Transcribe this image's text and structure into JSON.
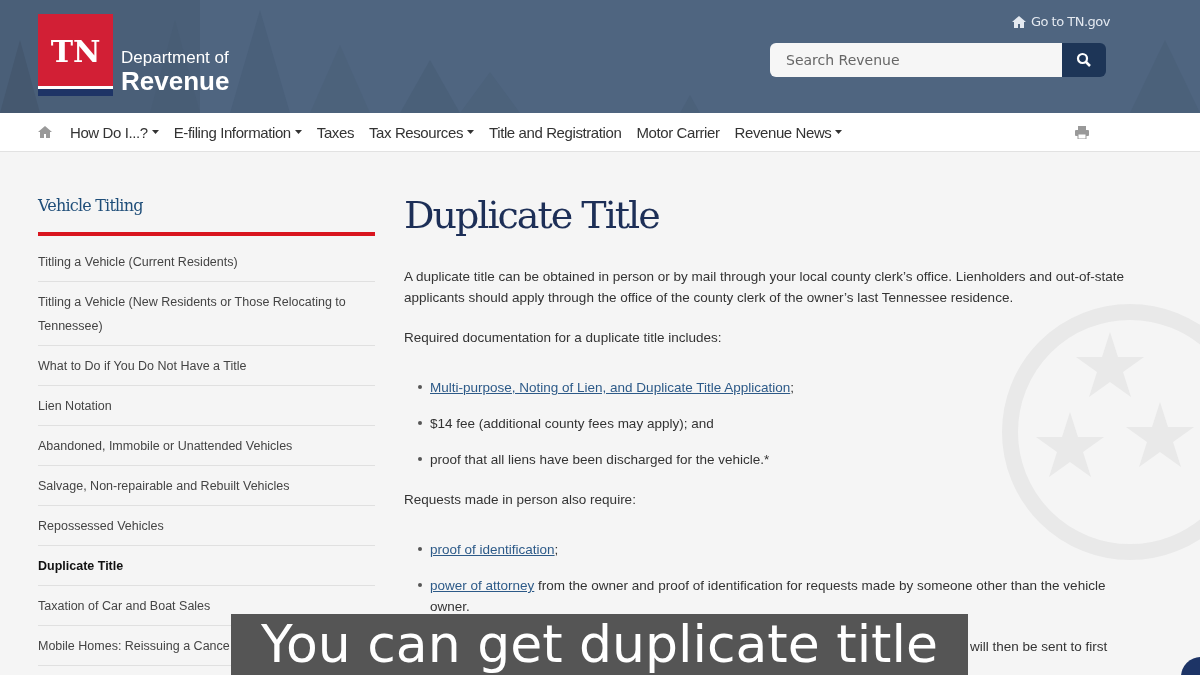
{
  "header": {
    "logo_mark": "TN",
    "logo_line1": "Department of",
    "logo_line2": "Revenue",
    "top_link": "Go to TN.gov",
    "search": {
      "placeholder": "Search Revenue"
    }
  },
  "nav": [
    {
      "label": "How Do I...?",
      "dropdown": true
    },
    {
      "label": "E-filing Information",
      "dropdown": true
    },
    {
      "label": "Taxes",
      "dropdown": false
    },
    {
      "label": "Tax Resources",
      "dropdown": true
    },
    {
      "label": "Title and Registration",
      "dropdown": false
    },
    {
      "label": "Motor Carrier",
      "dropdown": false
    },
    {
      "label": "Revenue News",
      "dropdown": true
    }
  ],
  "sidebar": {
    "title": "Vehicle Titling",
    "items": [
      {
        "label": "Titling a Vehicle (Current Residents)",
        "selected": false
      },
      {
        "label": "Titling a Vehicle (New Residents or Those Relocating to Tennessee)",
        "selected": false
      },
      {
        "label": "What to Do if You Do Not Have a Title",
        "selected": false
      },
      {
        "label": "Lien Notation",
        "selected": false
      },
      {
        "label": "Abandoned, Immobile or Unattended Vehicles",
        "selected": false
      },
      {
        "label": "Salvage, Non-repairable and Rebuilt Vehicles",
        "selected": false
      },
      {
        "label": "Repossessed Vehicles",
        "selected": false
      },
      {
        "label": "Duplicate Title",
        "selected": true
      },
      {
        "label": "Taxation of Car and Boat Sales",
        "selected": false
      },
      {
        "label": "Mobile Homes: Reissuing a Cance",
        "selected": false
      }
    ]
  },
  "content": {
    "title": "Duplicate Title",
    "blocks": [
      {
        "kind": "paragraph",
        "text": "A duplicate title can be obtained in person or by mail through your local county clerk’s office. Lienholders and out-of-state applicants should apply through the office of the county clerk of the owner’s last Tennessee residence."
      },
      {
        "kind": "paragraph",
        "text": "Required documentation for a duplicate title includes:"
      },
      {
        "kind": "list",
        "items": [
          {
            "link": "Multi-purpose, Noting of Lien, and Duplicate Title Application",
            "text": ";"
          },
          {
            "text": "$14 fee (additional county fees may apply); and"
          },
          {
            "text": "proof that all liens have been discharged for the vehicle.*"
          }
        ]
      },
      {
        "kind": "paragraph",
        "text": "Requests made in person also require:"
      },
      {
        "kind": "list",
        "items": [
          {
            "link": "proof of identification",
            "text": ";"
          },
          {
            "link": "power of attorney",
            "text": " from the owner and proof of identification for requests made by someone other than the vehicle owner."
          }
        ]
      },
      {
        "kind": "fragment",
        "text": "will then be sent to first"
      }
    ]
  },
  "caption": "You can get duplicate title"
}
